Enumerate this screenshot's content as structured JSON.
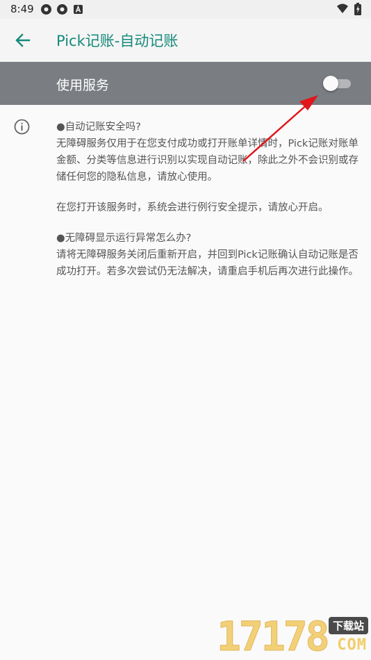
{
  "status_bar": {
    "time": "8:49",
    "left_icons": [
      "notification-icon",
      "notification-icon",
      "app-a-icon"
    ],
    "right_icons": [
      "wifi-icon",
      "battery-charging-icon"
    ]
  },
  "app_bar": {
    "back_icon": "arrow-left-icon",
    "title": "Pick记账-自动记账",
    "accent_color": "#15897a"
  },
  "service_toggle": {
    "label": "使用服务",
    "enabled": false,
    "bar_color": "#7a7d82"
  },
  "info": {
    "icon": "info-icon",
    "paragraphs": [
      "●自动记账安全吗?",
      "无障碍服务仅用于在您支付成功或打开账单详情时，Pick记账对账单金额、分类等信息进行识别以实现自动记账，除此之外不会识别或存储任何您的隐私信息，请放心使用。",
      "在您打开该服务时，系统会进行例行安全提示，请放心开启。",
      "●无障碍显示运行异常怎么办?",
      "请将无障碍服务关闭后重新开启，并回到Pick记账确认自动记账是否成功打开。若多次尝试仍无法解决，请重启手机后再次进行此操作。"
    ]
  },
  "annotation": {
    "arrow_color": "#e0161b"
  },
  "watermark": {
    "digits": "17178",
    "tag": "下载站",
    "domain": "COM"
  }
}
